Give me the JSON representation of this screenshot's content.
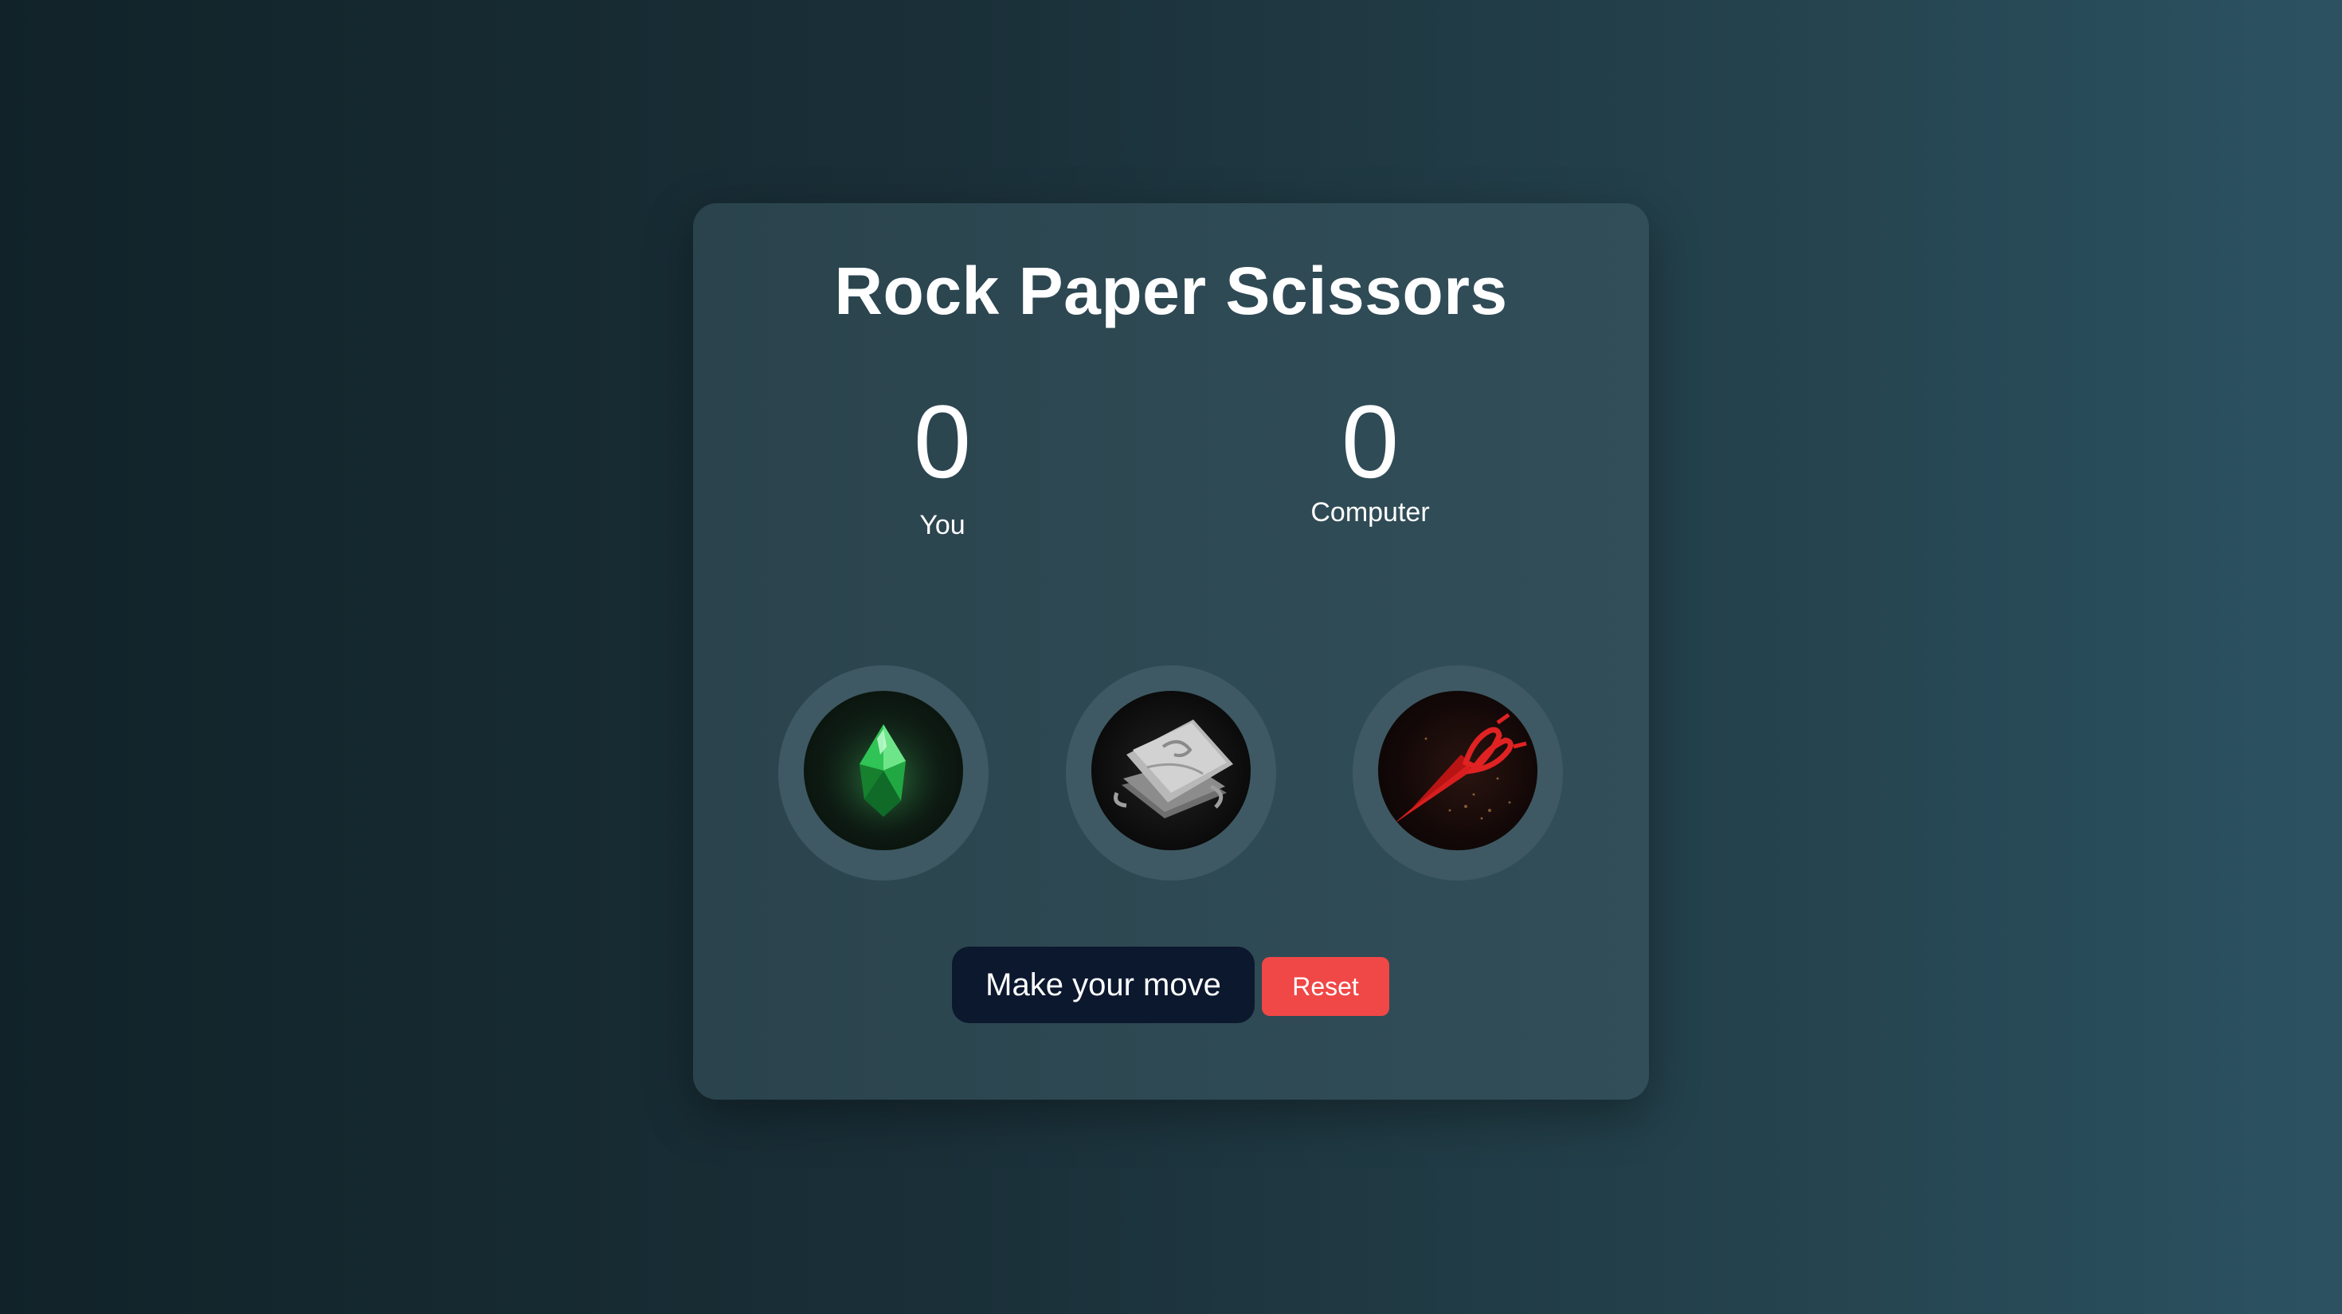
{
  "game": {
    "title": "Rock Paper Scissors"
  },
  "scores": {
    "player": {
      "value": "0",
      "label": "You"
    },
    "computer": {
      "value": "0",
      "label": "Computer"
    }
  },
  "choices": [
    {
      "name": "rock",
      "icon": "green-crystal-icon"
    },
    {
      "name": "paper",
      "icon": "paper-stack-icon"
    },
    {
      "name": "scissors",
      "icon": "red-scissors-icon"
    }
  ],
  "actions": {
    "move_label": "Make your move",
    "reset_label": "Reset"
  },
  "colors": {
    "move_button": "#0c182e",
    "reset_button": "#f04747",
    "choice_ring": "#3e5963"
  }
}
